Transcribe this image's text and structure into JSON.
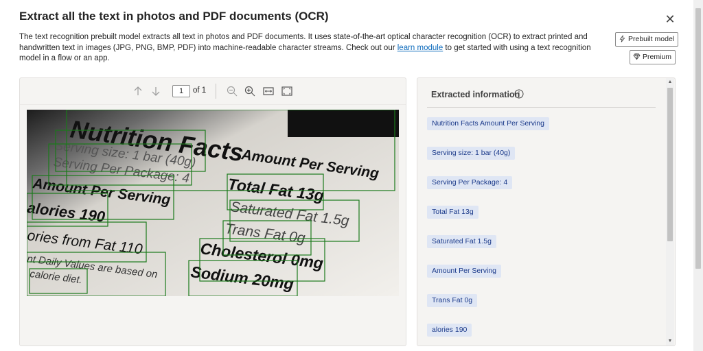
{
  "dialog": {
    "title": "Extract all the text in photos and PDF documents (OCR)",
    "close_icon": "close-icon",
    "description_before": "The text recognition prebuilt model extracts all text in photos and PDF documents. It uses state-of-the-art optical character recognition (OCR) to extract printed and handwritten text in images (JPG, PNG, BMP, PDF) into machine-readable character streams. Check out our ",
    "description_link": "learn module",
    "description_after": " to get started with using a text recognition model in a flow or an app.",
    "badges": {
      "prebuilt": "Prebuilt model",
      "premium": "Premium"
    }
  },
  "viewer": {
    "page_current": "1",
    "page_of": "of 1",
    "icons": [
      "arrow-up-icon",
      "arrow-down-icon",
      "zoom-out-icon",
      "zoom-in-icon",
      "fit-width-icon",
      "fit-page-icon"
    ],
    "box_color": "#1a7a1a"
  },
  "panel": {
    "heading": "Extracted information",
    "items": [
      "Nutrition Facts Amount Per Serving",
      "Serving size: 1 bar (40g)",
      "Serving Per Package: 4",
      "Total Fat 13g",
      "Saturated Fat 1.5g",
      "Amount Per Serving",
      "Trans Fat 0g",
      "alories 190"
    ],
    "chip_bg": "#dfe6f4",
    "chip_text": "#1b3a8a"
  }
}
